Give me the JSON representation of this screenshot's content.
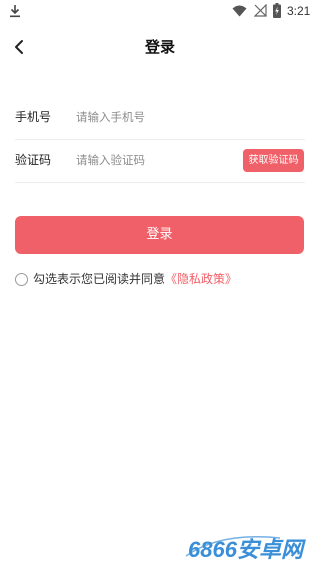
{
  "status_bar": {
    "time": "3:21",
    "icons": [
      "download-icon",
      "wifi-icon",
      "no-signal-icon",
      "battery-charging-icon"
    ]
  },
  "header": {
    "title": "登录",
    "back_icon": "chevron-left-icon"
  },
  "form": {
    "phone": {
      "label": "手机号",
      "placeholder": "请输入手机号",
      "value": ""
    },
    "code": {
      "label": "验证码",
      "placeholder": "请输入验证码",
      "value": "",
      "get_code_label": "获取验证码"
    }
  },
  "login_button": "登录",
  "agreement": {
    "checked": false,
    "text": "勾选表示您已阅读并同意",
    "link": "《隐私政策》"
  },
  "watermark": {
    "text": "6866安卓网"
  },
  "colors": {
    "accent": "#f06068",
    "watermark_blue": "#3a8fd8"
  }
}
